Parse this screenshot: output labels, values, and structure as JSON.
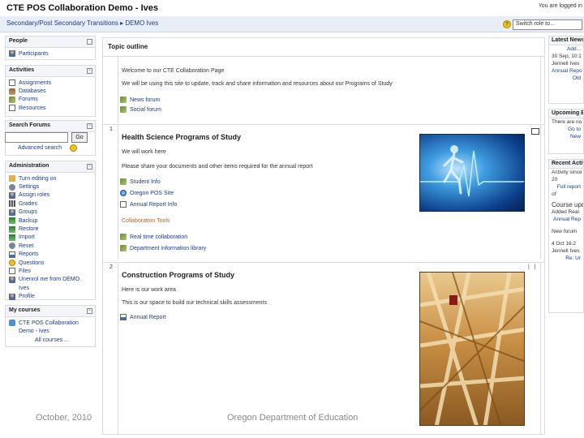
{
  "header": {
    "site_title": "CTE POS Collaboration Demo - Ives",
    "logged_in": "You are logged in",
    "breadcrumb": "Secondary/Post Secondary Transitions ▸ DEMO Ives",
    "role_select": "Switch role to...",
    "role_help_icon": "help-icon"
  },
  "left": {
    "people": {
      "title": "People",
      "items": [
        {
          "label": "Participants",
          "icon": "participants-icon"
        }
      ]
    },
    "activities": {
      "title": "Activities",
      "items": [
        {
          "label": "Assignments",
          "icon": "assignment-icon"
        },
        {
          "label": "Databases",
          "icon": "database-icon"
        },
        {
          "label": "Forums",
          "icon": "forum-icon"
        },
        {
          "label": "Resources",
          "icon": "resource-icon"
        }
      ]
    },
    "search": {
      "title": "Search Forums",
      "go": "Go",
      "advanced": "Advanced search"
    },
    "administration": {
      "title": "Administration",
      "items": [
        {
          "label": "Turn editing on",
          "icon": "edit-icon"
        },
        {
          "label": "Settings",
          "icon": "settings-icon"
        },
        {
          "label": "Assign roles",
          "icon": "roles-icon"
        },
        {
          "label": "Grades",
          "icon": "grades-icon"
        },
        {
          "label": "Groups",
          "icon": "groups-icon"
        },
        {
          "label": "Backup",
          "icon": "backup-icon"
        },
        {
          "label": "Restore",
          "icon": "restore-icon"
        },
        {
          "label": "Import",
          "icon": "import-icon"
        },
        {
          "label": "Reset",
          "icon": "reset-icon"
        },
        {
          "label": "Reports",
          "icon": "reports-icon"
        },
        {
          "label": "Questions",
          "icon": "questions-icon"
        },
        {
          "label": "Files",
          "icon": "files-icon"
        },
        {
          "label": "Unenrol me from DEMO",
          "icon": "unenrol-icon"
        },
        {
          "label": "Ives",
          "icon": ""
        },
        {
          "label": "Profile",
          "icon": "profile-icon"
        }
      ]
    },
    "my_courses": {
      "title": "My courses",
      "items": [
        {
          "label": "CTE POS Collaboration",
          "icon": "course-icon"
        },
        {
          "label": "Demo - Ives",
          "icon": ""
        }
      ],
      "all_courses": "All courses ..."
    }
  },
  "main": {
    "title": "Topic outline",
    "section0": {
      "lines": [
        "Welcome to our CTE Collaboration Page",
        "We will be using this site to update, track and share information and resources about our Programs of Study"
      ],
      "links": [
        {
          "label": "News forum",
          "icon": "forum-icon"
        },
        {
          "label": "Social forum",
          "icon": "forum-icon"
        }
      ]
    },
    "section1": {
      "number": "1",
      "title": "Health Science Programs of Study",
      "text1": "We will work here",
      "text2": "Please share your documents and other items required for the annual report",
      "links": [
        {
          "label": "Student Info",
          "icon": "document-icon"
        },
        {
          "label": "Oregon POS Site",
          "icon": "web-icon"
        },
        {
          "label": "Annual Report Info",
          "icon": "document-icon"
        }
      ],
      "subheading": "Collaboration Tools",
      "tools": [
        {
          "label": "Real time collaboration",
          "icon": "collaboration-icon"
        },
        {
          "label": "Department information library",
          "icon": "library-icon"
        }
      ]
    },
    "section2": {
      "number": "2",
      "title": "Construction Programs of Study",
      "text1": "Here is our work area",
      "text2": "This is our space to build our technical skills assessments",
      "links": [
        {
          "label": "Annual Report",
          "icon": "report-icon"
        }
      ]
    }
  },
  "right": {
    "latest_news": {
      "title": "Latest News",
      "lines": [
        "Add...",
        "30 Sep, 10:1",
        "Jennell Ives",
        "Annual Repo",
        "Old"
      ]
    },
    "upcoming": {
      "title": "Upcoming Events",
      "lines": [
        "There are no",
        "Go to",
        "New"
      ]
    },
    "recent": {
      "title": "Recent Activity",
      "lines": [
        "Activity since",
        "20",
        "Full report",
        "of",
        "Course upd",
        "Added Real",
        "Annual Rep",
        "New forum",
        "4 Oct 16:2",
        "Jennell Ives",
        "Re: Ur"
      ]
    }
  },
  "footer": {
    "date": "October, 2010",
    "org": "Oregon Department of Education"
  }
}
